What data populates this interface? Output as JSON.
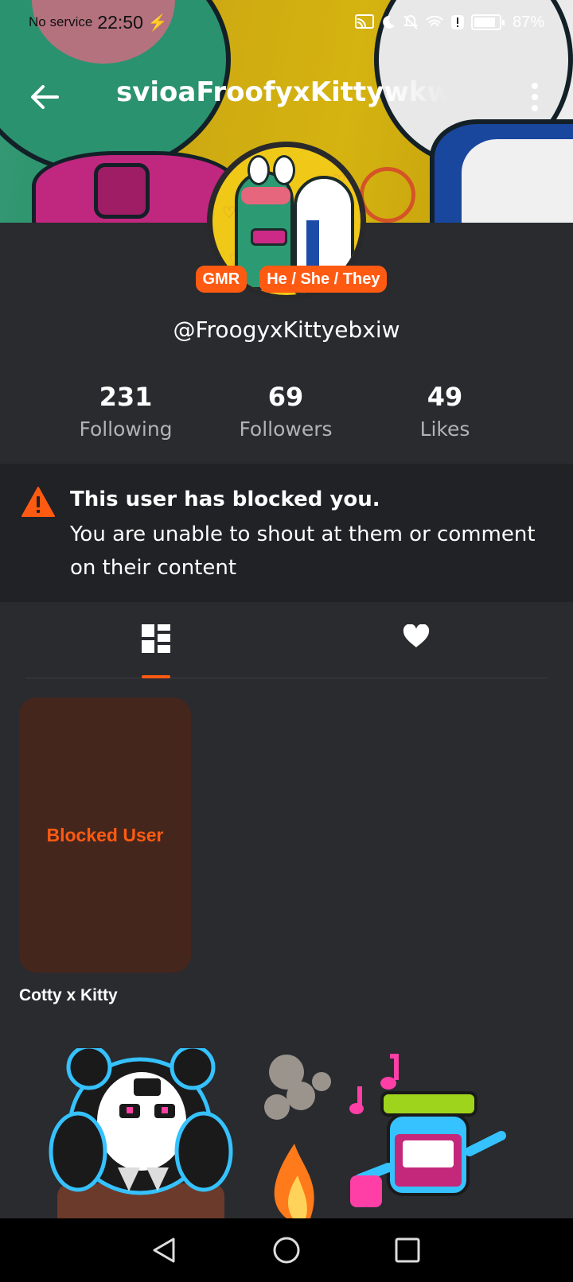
{
  "status_bar": {
    "carrier": "No service",
    "time": "22:50",
    "battery": "87%"
  },
  "header": {
    "title": "svioaFroofyxKittywkw"
  },
  "profile": {
    "tags": [
      "GMR",
      "He / She / They"
    ],
    "handle": "@FroogyxKittyebxiw"
  },
  "stats": [
    {
      "value": "231",
      "label": "Following"
    },
    {
      "value": "69",
      "label": "Followers"
    },
    {
      "value": "49",
      "label": "Likes"
    }
  ],
  "notice": {
    "title": "This user has blocked you.",
    "body": "You are unable to shout at them or comment on their content"
  },
  "tabs": [
    {
      "icon": "grid-layout-icon",
      "active": true
    },
    {
      "icon": "heart-icon",
      "active": false
    }
  ],
  "content": {
    "card_label": "Blocked User",
    "card_caption": "Cotty x Kitty"
  },
  "colors": {
    "accent": "#ff5a12",
    "background": "#292b2f",
    "notice_bg": "#202225",
    "card_bg": "#45261d"
  }
}
